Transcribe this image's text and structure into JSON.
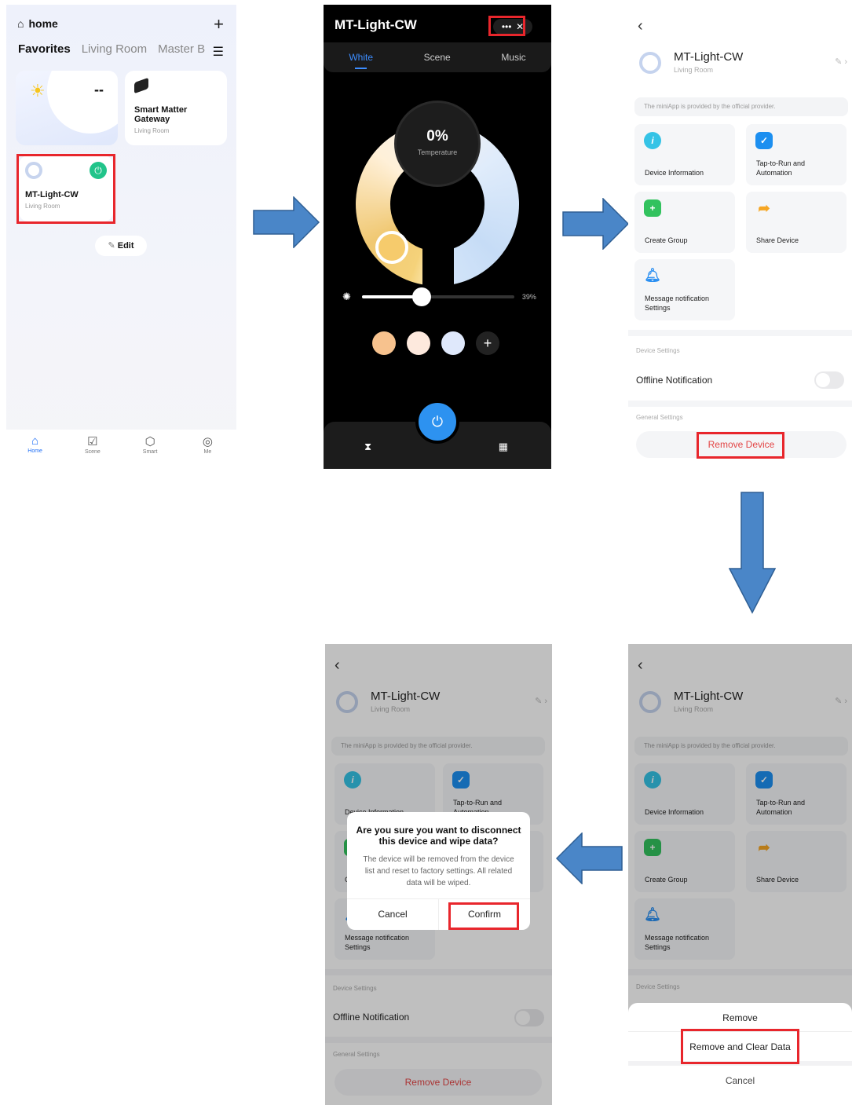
{
  "home": {
    "title": "home",
    "tabs": [
      "Favorites",
      "Living Room",
      "Master B"
    ],
    "weather_value": "--",
    "gateway": {
      "name": "Smart Matter\nGateway",
      "room": "Living Room"
    },
    "light": {
      "name": "MT-Light-CW",
      "room": "Living Room"
    },
    "edit_label": "Edit",
    "nav": [
      "Home",
      "Scene",
      "Smart",
      "Me"
    ]
  },
  "control": {
    "title": "MT-Light-CW",
    "tabs": [
      "White",
      "Scene",
      "Music"
    ],
    "temp_value": "0%",
    "temp_label": "Temperature",
    "brightness_label": "39%",
    "brightness": 0.39
  },
  "settings": {
    "device_name": "MT-Light-CW",
    "device_room": "Living Room",
    "notice": "The miniApp is provided by the official provider.",
    "tiles": [
      "Device Information",
      "Tap-to-Run and Automation",
      "Create Group",
      "Share Device",
      "Message notification Settings"
    ],
    "section_device": "Device Settings",
    "offline": "Offline Notification",
    "section_general": "General Settings",
    "remove": "Remove Device"
  },
  "sheet": {
    "remove": "Remove",
    "remove_clear": "Remove and Clear Data",
    "cancel": "Cancel"
  },
  "dialog": {
    "title": "Are you sure you want to disconnect this device and wipe data?",
    "message": "The device will be removed from the device list and reset to factory settings. All related data will be wiped.",
    "cancel": "Cancel",
    "confirm": "Confirm"
  },
  "colors": {
    "highlight": "#e8262c",
    "arrow": "#4a86c8",
    "accent": "#1f6ff6",
    "danger": "#e34545"
  }
}
